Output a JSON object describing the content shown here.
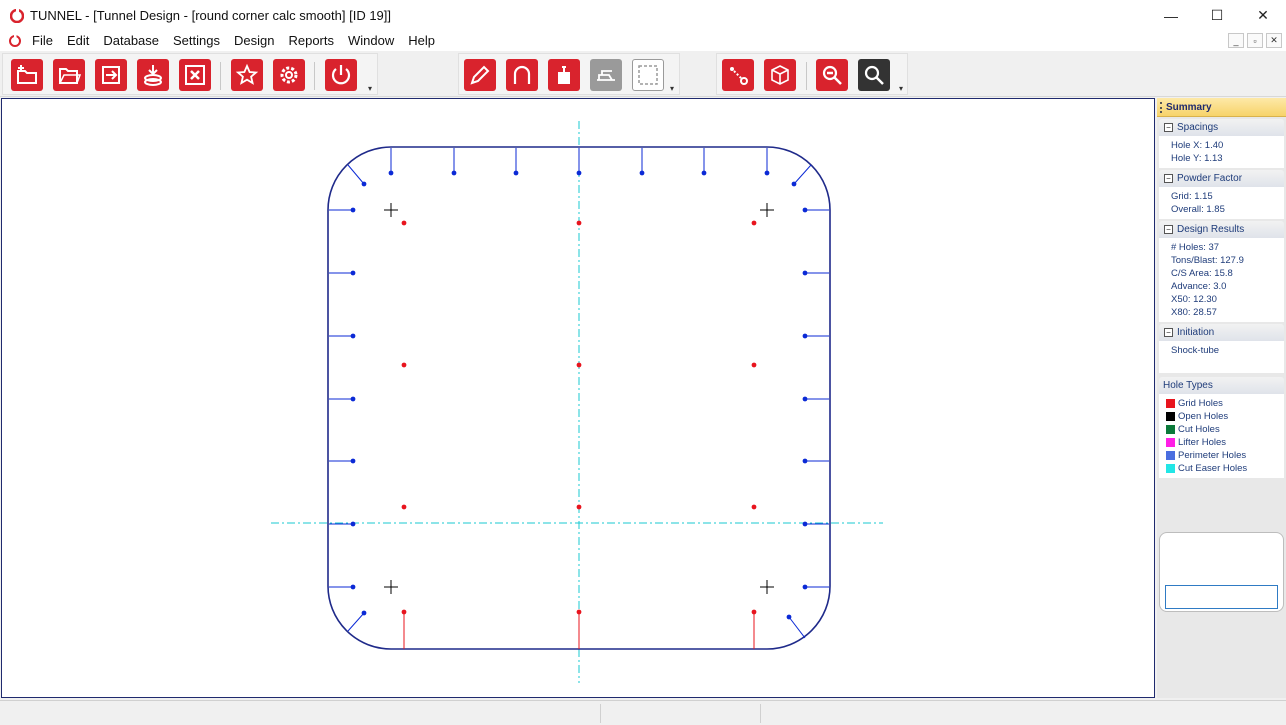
{
  "window": {
    "title": "TUNNEL - [Tunnel Design - [round corner calc smooth] [ID 19]]",
    "minimize": "—",
    "maximize": "☐",
    "close": "✕"
  },
  "menu": {
    "items": [
      "File",
      "Edit",
      "Database",
      "Settings",
      "Design",
      "Reports",
      "Window",
      "Help"
    ],
    "mdi": {
      "minimize": "_",
      "restore": "▫",
      "close": "✕"
    }
  },
  "toolbar": {
    "chevron": "▾"
  },
  "summary": {
    "header": "Summary",
    "sections": [
      {
        "title": "Spacings",
        "toggle": "−",
        "lines": [
          "Hole X: 1.40",
          "Hole Y: 1.13"
        ]
      },
      {
        "title": "Powder Factor",
        "toggle": "−",
        "lines": [
          "Grid: 1.15",
          "Overall: 1.85"
        ]
      },
      {
        "title": "Design Results",
        "toggle": "−",
        "lines": [
          "# Holes: 37",
          "Tons/Blast: 127.9",
          "C/S Area: 15.8",
          "Advance: 3.0",
          "X50: 12.30",
          "X80: 28.57"
        ]
      },
      {
        "title": "Initiation",
        "toggle": "−",
        "lines": [
          "Shock-tube"
        ]
      }
    ],
    "hole_types": {
      "title": "Hole Types",
      "items": [
        {
          "label": "Grid Holes",
          "color": "#e8141e"
        },
        {
          "label": "Open Holes",
          "color": "#000000"
        },
        {
          "label": "Cut Holes",
          "color": "#0b7a3a"
        },
        {
          "label": "Lifter Holes",
          "color": "#ff1ee6"
        },
        {
          "label": "Perimeter Holes",
          "color": "#4a6ee0"
        },
        {
          "label": "Cut Easer Holes",
          "color": "#22e6e6"
        }
      ]
    },
    "input_value": ""
  },
  "colors": {
    "accent_red": "#d9232d",
    "outline_blue": "#1f2a8a",
    "perimeter_blue": "#0b2ad6",
    "grid_red": "#e8141e",
    "centerline": "#19c8d2"
  }
}
